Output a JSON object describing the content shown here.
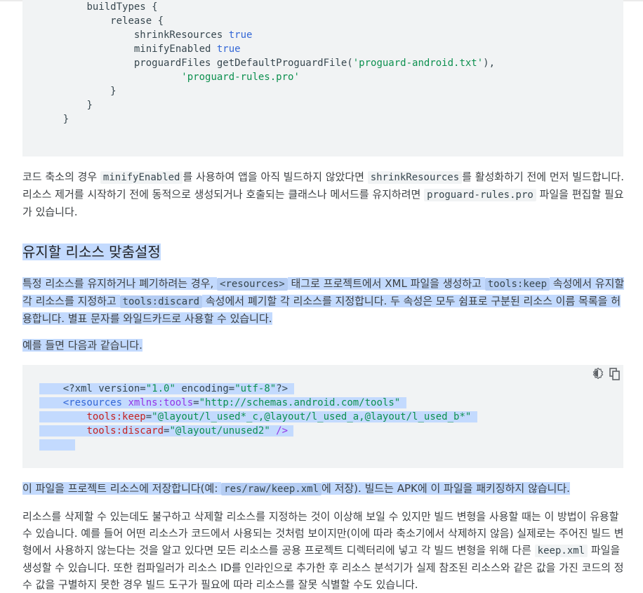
{
  "gradle_code": {
    "lines": [
      {
        "indent": "        ",
        "parts": [
          {
            "t": "buildTypes {",
            "c": ""
          }
        ]
      },
      {
        "indent": "            ",
        "parts": [
          {
            "t": "release {",
            "c": ""
          }
        ]
      },
      {
        "indent": "                ",
        "parts": [
          {
            "t": "shrinkResources ",
            "c": ""
          },
          {
            "t": "true",
            "c": "kw"
          }
        ]
      },
      {
        "indent": "                ",
        "parts": [
          {
            "t": "minifyEnabled ",
            "c": ""
          },
          {
            "t": "true",
            "c": "kw"
          }
        ]
      },
      {
        "indent": "                ",
        "parts": [
          {
            "t": "proguardFiles getDefaultProguardFile(",
            "c": ""
          },
          {
            "t": "'proguard-android.txt'",
            "c": "str"
          },
          {
            "t": "),",
            "c": ""
          }
        ]
      },
      {
        "indent": "                        ",
        "parts": [
          {
            "t": "'proguard-rules.pro'",
            "c": "str"
          }
        ]
      },
      {
        "indent": "            ",
        "parts": [
          {
            "t": "}",
            "c": ""
          }
        ]
      },
      {
        "indent": "        ",
        "parts": [
          {
            "t": "}",
            "c": ""
          }
        ]
      },
      {
        "indent": "    ",
        "parts": [
          {
            "t": "}",
            "c": ""
          }
        ]
      }
    ]
  },
  "para1": {
    "a": "코드 축소의 경우 ",
    "code1": "minifyEnabled",
    "b": "를 사용하여 앱을 아직 빌드하지 않았다면 ",
    "code2": "shrinkResources",
    "c": "를 활성화하기 전에 먼저 빌드합니다. 리소스 제거를 시작하기 전에 동적으로 생성되거나 호출되는 클래스나 메서드를 유지하려면 ",
    "code3": "proguard-rules.pro",
    "d": " 파일을 편집할 필요가 있습니다."
  },
  "heading": "유지할 리소스 맞춤설정",
  "para2": {
    "a": "특정 리소스를 유지하거나 폐기하려는 경우, ",
    "code1": "<resources>",
    "b": " 태그로 프로젝트에서 XML 파일을 생성하고 ",
    "code2": "tools:keep",
    "c": " 속성에서 유지할 각 리소스를 지정하고 ",
    "code3": "tools:discard",
    "d": " 속성에서 폐기할 각 리소스를 지정합니다. 두 속성은 모두 쉼표로 구분된 리소스 이름 목록을 허용합니다. 별표 문자를 와일드카드로 사용할 수 있습니다."
  },
  "para3": "예를 들면 다음과 같습니다.",
  "xml_code": {
    "line1": {
      "p1": "<?xml version=",
      "v1": "\"1.0\"",
      "p2": " encoding=",
      "v2": "\"utf-8\"",
      "p3": "?>"
    },
    "line2": {
      "tag": "<resources",
      "attr": " xmlns:tools",
      "eq": "=",
      "val": "\"http://schemas.android.com/tools\""
    },
    "line3": {
      "attr": "tools:keep",
      "eq": "=",
      "val": "\"@layout/l_used*_c,@layout/l_used_a,@layout/l_used_b*\""
    },
    "line4": {
      "attr": "tools:discard",
      "eq": "=",
      "val": "\"@layout/unused2\"",
      "end": " />"
    }
  },
  "icons": {
    "theme": "dark-code-theme-icon",
    "copy": "copy-code-icon"
  },
  "para4": {
    "a": "이 파일을 프로젝트 리소스에 저장합니다(예: ",
    "code1": "res/raw/keep.xml",
    "b": "에 저장). 빌드는 APK에 이 파일을 패키징하지 않습니다."
  },
  "para5": {
    "a": "리소스를 삭제할 수 있는데도 불구하고 삭제할 리소스를 지정하는 것이 이상해 보일 수 있지만 빌드 변형을 사용할 때는 이 방법이 유용할 수 있습니다. 예를 들어 어떤 리소스가 코드에서 사용되는 것처럼 보이지만(이에 따라 축소기에서 삭제하지 않음) 실제로는 주어진 빌드 변형에서 사용하지 않는다는 것을 알고 있다면 모든 리소스를 공용 프로젝트 디렉터리에 넣고 각 빌드 변형을 위해 다른 ",
    "code1": "keep.xml",
    "b": " 파일을 생성할 수 있습니다. 또한 컴파일러가 리소스 ID를 인라인으로 추가한 후 리소스 분석기가 실제 참조된 리소스와 같은 값을 가진 코드의 정수 값을 구별하지 못한 경우 빌드 도구가 필요에 따라 리소스를 잘못 식별할 수도 있습니다."
  },
  "colors": {
    "code_bg": "#f1f3f4",
    "selection": "#c3dafe",
    "keyword": "#3367d6",
    "string": "#0d904f"
  }
}
